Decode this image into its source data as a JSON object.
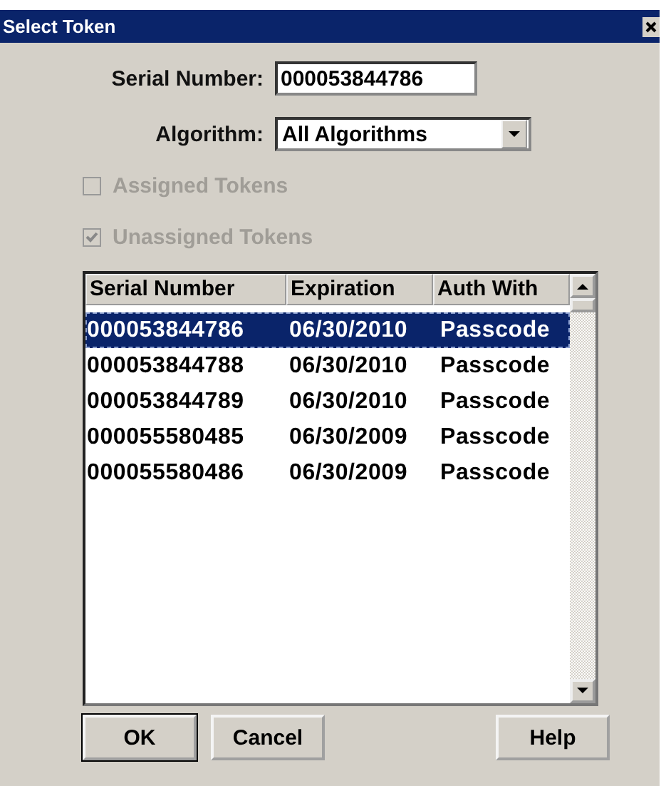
{
  "window": {
    "title": "Select Token"
  },
  "serial_number": {
    "label": "Serial Number:",
    "value": "000053844786"
  },
  "algorithm": {
    "label": "Algorithm:",
    "value": "All Algorithms"
  },
  "checkboxes": [
    {
      "label": "Assigned Tokens",
      "checked": false,
      "disabled": true
    },
    {
      "label": "Unassigned Tokens",
      "checked": true,
      "disabled": true
    }
  ],
  "table": {
    "columns": [
      "Serial Number",
      "Expiration",
      "Auth With"
    ],
    "rows": [
      {
        "cells": [
          "000053844786",
          "06/30/2010",
          "Passcode"
        ],
        "selected": true
      },
      {
        "cells": [
          "000053844788",
          "06/30/2010",
          "Passcode"
        ],
        "selected": false
      },
      {
        "cells": [
          "000053844789",
          "06/30/2010",
          "Passcode"
        ],
        "selected": false
      },
      {
        "cells": [
          "000055580485",
          "06/30/2009",
          "Passcode"
        ],
        "selected": false
      },
      {
        "cells": [
          "000055580486",
          "06/30/2009",
          "Passcode"
        ],
        "selected": false
      }
    ]
  },
  "buttons": [
    {
      "label": "OK",
      "default": true
    },
    {
      "label": "Cancel",
      "default": false
    },
    {
      "label": "Help",
      "default": false
    }
  ]
}
